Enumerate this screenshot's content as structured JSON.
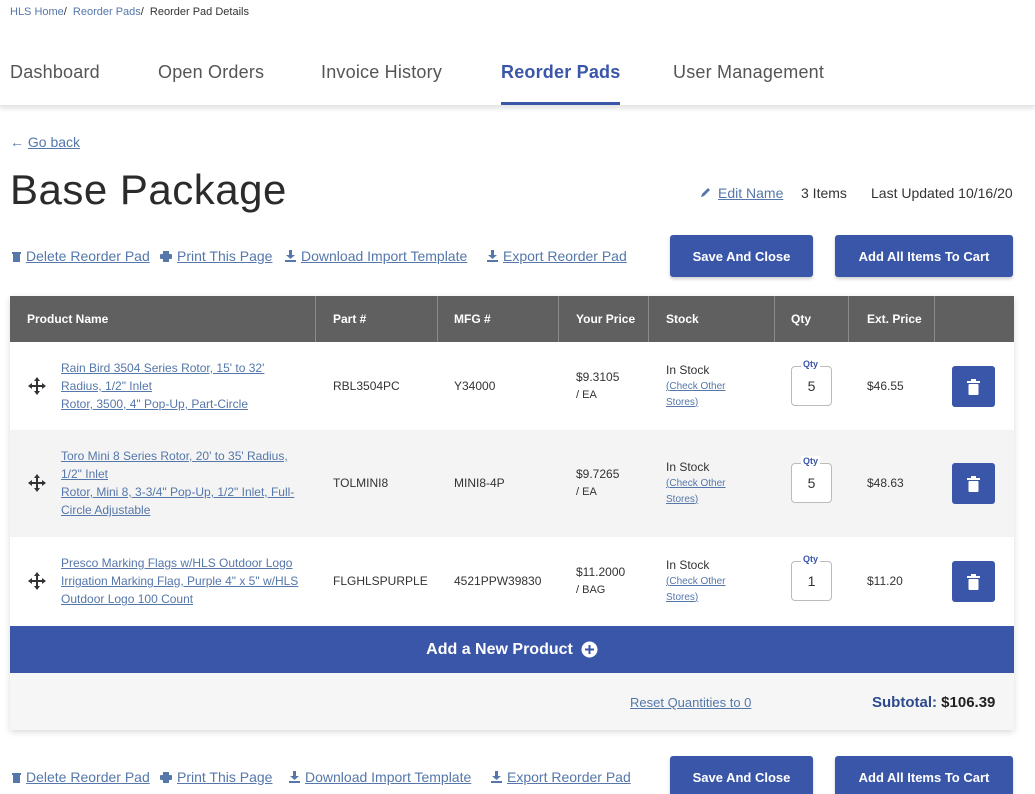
{
  "breadcrumb": {
    "home": "HLS Home",
    "reorder_pads": "Reorder Pads",
    "current": "Reorder Pad Details",
    "sep": "/"
  },
  "tabs": [
    {
      "label": "Dashboard",
      "active": false
    },
    {
      "label": "Open Orders",
      "active": false
    },
    {
      "label": "Invoice History",
      "active": false
    },
    {
      "label": "Reorder Pads",
      "active": true
    },
    {
      "label": "User Management",
      "active": false
    }
  ],
  "go_back": "Go back",
  "page_title": "Base Package",
  "meta": {
    "edit_name": "Edit Name",
    "item_count": "3 Items",
    "last_updated": "Last Updated 10/16/20"
  },
  "actions": {
    "delete": "Delete Reorder Pad",
    "print": "Print This Page",
    "download": "Download Import Template",
    "export": "Export Reorder Pad",
    "save_close": "Save And Close",
    "add_all": "Add All Items To Cart"
  },
  "table": {
    "headers": [
      "Product Name",
      "Part #",
      "MFG #",
      "Your Price",
      "Stock",
      "Qty",
      "Ext. Price"
    ],
    "qty_label": "Qty",
    "check_stores_open": "(",
    "check_stores_1": "Check Other",
    "check_stores_2": "Stores",
    "check_stores_close": ")",
    "rows": [
      {
        "name_lines": [
          "Rain Bird 3504 Series Rotor, 15' to 32'",
          "Radius, 1/2\" Inlet",
          "Rotor, 3500, 4\" Pop-Up, Part-Circle"
        ],
        "part": "RBL3504PC",
        "mfg": "Y34000",
        "price": "$9.3105",
        "unit": "/ EA",
        "stock": "In Stock",
        "qty": "5",
        "ext": "$46.55"
      },
      {
        "name_lines": [
          "Toro Mini 8 Series Rotor, 20' to 35' Radius,",
          "1/2\" Inlet",
          "Rotor, Mini 8, 3-3/4\" Pop-Up, 1/2\" Inlet, Full-",
          "Circle Adjustable"
        ],
        "part": "TOLMINI8",
        "mfg": "MINI8-4P",
        "price": "$9.7265",
        "unit": "/ EA",
        "stock": "In Stock",
        "qty": "5",
        "ext": "$48.63"
      },
      {
        "name_lines": [
          "Presco Marking Flags w/HLS Outdoor Logo",
          "Irrigation Marking Flag, Purple 4\" x 5\" w/HLS",
          "Outdoor Logo 100 Count"
        ],
        "part": "FLGHLSPURPLE",
        "mfg": "4521PPW39830",
        "price": "$11.2000",
        "unit": "/ BAG",
        "stock": "In Stock",
        "qty": "1",
        "ext": "$11.20"
      }
    ]
  },
  "add_new_product": "Add a New Product",
  "reset_quantities": "Reset Quantities to 0",
  "subtotal": {
    "label": "Subtotal:",
    "value": "$106.39"
  },
  "colors": {
    "primary": "#3a56a8",
    "link": "#5577aa",
    "header_bg": "#606060"
  },
  "icons": [
    "left-arrow-icon",
    "pencil-icon",
    "trash-icon",
    "printer-icon",
    "download-icon",
    "move-icon",
    "plus-circle-icon"
  ]
}
